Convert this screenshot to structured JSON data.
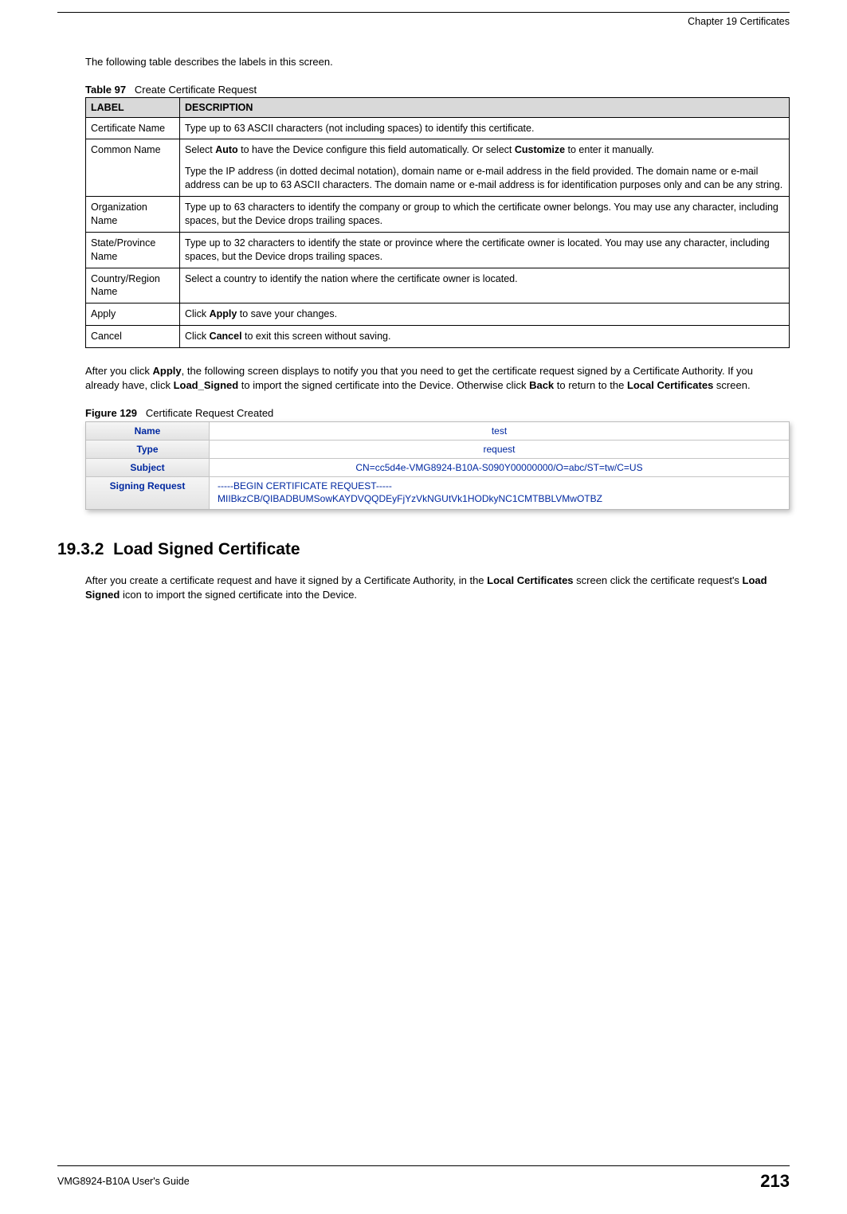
{
  "header": {
    "chapter": "Chapter 19 Certificates"
  },
  "intro": "The following table describes the labels in this screen.",
  "table97": {
    "caption_prefix": "Table 97",
    "caption_title": "Create Certificate Request",
    "header_label": "LABEL",
    "header_desc": "DESCRIPTION",
    "rows": [
      {
        "label": "Certificate Name",
        "desc": "Type up to 63 ASCII characters (not including spaces) to identify this certificate."
      },
      {
        "label": "Common Name",
        "desc_p1_a": "Select ",
        "desc_p1_b_bold": "Auto",
        "desc_p1_c": " to have the Device configure this field automatically. Or select ",
        "desc_p1_d_bold": "Customize",
        "desc_p1_e": " to enter it manually.",
        "desc_p2": "Type the IP address (in dotted decimal notation), domain name or e-mail address in the field provided. The domain name or e-mail address can be up to 63 ASCII characters. The domain name or e-mail address is for identification purposes only and can be any string."
      },
      {
        "label": "Organization Name",
        "desc": "Type up to 63 characters to identify the company or group to which the certificate owner belongs. You may use any character, including spaces, but the Device drops trailing spaces."
      },
      {
        "label": "State/Province Name",
        "desc": "Type up to 32 characters to identify the state or province where the certificate owner is located. You may use any character, including spaces, but the Device drops trailing spaces."
      },
      {
        "label": "Country/Region Name",
        "desc": "Select a country to identify the nation where the certificate owner is located."
      },
      {
        "label": "Apply",
        "desc_a": "Click ",
        "desc_b_bold": "Apply",
        "desc_c": " to save your changes."
      },
      {
        "label": "Cancel",
        "desc_a": "Click ",
        "desc_b_bold": "Cancel",
        "desc_c": " to exit this screen without saving."
      }
    ]
  },
  "after_table": {
    "a": "After you click ",
    "b_bold": "Apply",
    "c": ", the following screen displays to notify you that you need to get the certificate request signed by a Certificate Authority. If you already have, click ",
    "d_bold": "Load_Signed",
    "e": " to import the signed certificate into the Device. Otherwise click ",
    "f_bold": "Back",
    "g": " to return to the ",
    "h_bold": "Local Certificates",
    "i": " screen."
  },
  "figure129": {
    "caption_prefix": "Figure 129",
    "caption_title": "Certificate Request Created",
    "rows": {
      "name_label": "Name",
      "name_value": "test",
      "type_label": "Type",
      "type_value": "request",
      "subject_label": "Subject",
      "subject_value": "CN=cc5d4e-VMG8924-B10A-S090Y00000000/O=abc/ST=tw/C=US",
      "signing_label": "Signing Request",
      "signing_value_l1": "-----BEGIN CERTIFICATE REQUEST-----",
      "signing_value_l2": "MIIBkzCB/QIBADBUMSowKAYDVQQDEyFjYzVkNGUtVk1HODkyNC1CMTBBLVMwOTBZ"
    }
  },
  "section": {
    "number": "19.3.2",
    "title": "Load Signed Certificate",
    "para_a": "After you create a certificate request and have it signed by a Certificate Authority, in the ",
    "para_b_bold": "Local Certificates",
    "para_c": " screen click the certificate request's ",
    "para_d_bold": "Load Signed",
    "para_e": " icon to import the signed certificate into the Device."
  },
  "footer": {
    "guide": "VMG8924-B10A User's Guide",
    "page": "213"
  }
}
